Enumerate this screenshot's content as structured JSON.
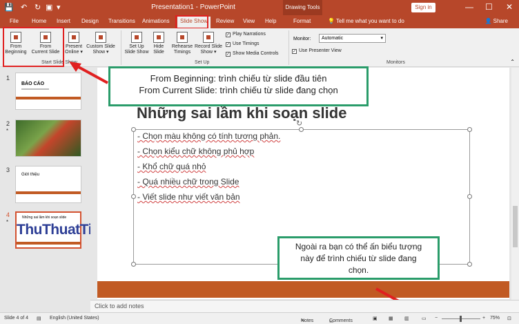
{
  "window": {
    "title": "Presentation1 - PowerPoint",
    "context_tab": "Drawing Tools",
    "signin": "Sign in",
    "minimize": "—",
    "restore": "☐",
    "close": "✕",
    "qa_icons": [
      "💾",
      "↶",
      "↻",
      "▣",
      "▾"
    ]
  },
  "tabs": [
    "File",
    "Home",
    "Insert",
    "Design",
    "Transitions",
    "Animations",
    "Slide Show",
    "Review",
    "View",
    "Help",
    "Format"
  ],
  "tell_me": "Tell me what you want to do",
  "share": "Share",
  "ribbon": {
    "start_group": {
      "label": "Start Slide Show",
      "from_beginning": "From\nBeginning",
      "from_current": "From\nCurrent Slide",
      "present_online": "Present\nOnline ▾",
      "custom": "Custom Slide\nShow ▾"
    },
    "setup_group": {
      "label": "Set Up",
      "setup_show": "Set Up\nSlide Show",
      "hide_slide": "Hide\nSlide",
      "rehearse": "Rehearse\nTimings",
      "record": "Record Slide\nShow ▾",
      "play_narrations": "Play Narrations",
      "use_timings": "Use Timings",
      "show_media": "Show Media Controls"
    },
    "monitors_group": {
      "label": "Monitors",
      "monitor_label": "Monitor:",
      "monitor_value": "Automatic",
      "presenter_view": "Use Presenter View"
    }
  },
  "thumbnails": {
    "numbers": [
      "1",
      "2",
      "3",
      "4"
    ],
    "slide1_title": "BÁO CÁO",
    "slide3_title": "Giới thiệu",
    "slide4_title": "Những sai lầm khi soạn slide"
  },
  "watermark": "ThuThuatTinHoc.vn",
  "slide": {
    "title": "Những sai lầm khi soạn slide",
    "bullets": [
      "- Chọn màu không có tính tương phản.",
      "- Chọn kiểu chữ không phủ hợp",
      "- Khổ chữ quá nhỏ",
      "- Quá nhiều chữ trong Slide",
      "- Viết slide như viết văn bản"
    ]
  },
  "callouts": {
    "top_line1": "From Beginning: trình chiếu từ slide đầu tiên",
    "top_line2": "From Current Slide: trình chiếu từ slide đang chọn",
    "bottom": "Ngoài ra bạn có thể ấn biểu tượng này để trình chiếu từ slide đang chọn."
  },
  "notes_placeholder": "Click to add notes",
  "status": {
    "slide_of": "Slide 4 of 4",
    "language": "English (United States)",
    "notes": "Notes",
    "comments": "Comments",
    "zoom": "75%"
  },
  "colors": {
    "accent": "#b7472a",
    "callout_border": "#2a9c6a",
    "highlight": "#e02020"
  }
}
